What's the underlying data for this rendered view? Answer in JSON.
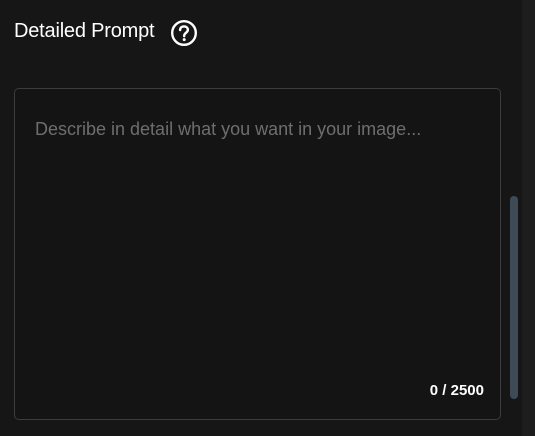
{
  "section": {
    "title": "Detailed Prompt",
    "help_icon": "question-circle-icon"
  },
  "prompt": {
    "placeholder": "Describe in detail what you want in your image...",
    "value": "",
    "counter": "0 / 2500"
  }
}
